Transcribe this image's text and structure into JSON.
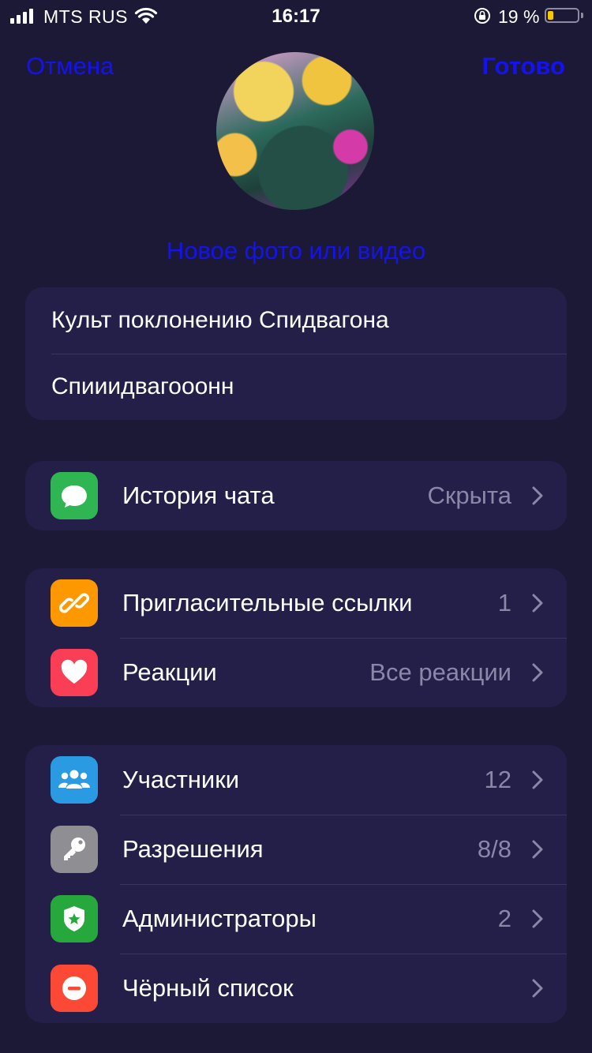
{
  "status_bar": {
    "carrier": "MTS RUS",
    "time": "16:17",
    "battery_percent": "19 %",
    "battery_level": 0.19
  },
  "nav": {
    "cancel_label": "Отмена",
    "done_label": "Готово"
  },
  "photo": {
    "change_label": "Новое фото или видео"
  },
  "info": {
    "name": "Культ поклонению Спидвагона",
    "description": "Спииидвагооонн"
  },
  "chat_history": {
    "label": "История чата",
    "value": "Скрыта",
    "icon": "message-bubble-icon",
    "color": "#2fb653"
  },
  "links_group": [
    {
      "label": "Пригласительные ссылки",
      "value": "1",
      "icon": "link-icon",
      "color": "#fe9800"
    },
    {
      "label": "Реакции",
      "value": "Все реакции",
      "icon": "heart-icon",
      "color": "#fa3e55"
    }
  ],
  "members_group": [
    {
      "label": "Участники",
      "value": "12",
      "icon": "people-icon",
      "color": "#2a9be3"
    },
    {
      "label": "Разрешения",
      "value": "8/8",
      "icon": "key-icon",
      "color": "#8e8e93"
    },
    {
      "label": "Администраторы",
      "value": "2",
      "icon": "shield-star-icon",
      "color": "#27a83c"
    },
    {
      "label": "Чёрный список",
      "value": "",
      "icon": "block-icon",
      "color": "#fb4935"
    }
  ],
  "colors": {
    "background": "#1c1937",
    "card": "#241f48",
    "accent": "#1413f0",
    "secondary_text": "#8b87a9"
  }
}
